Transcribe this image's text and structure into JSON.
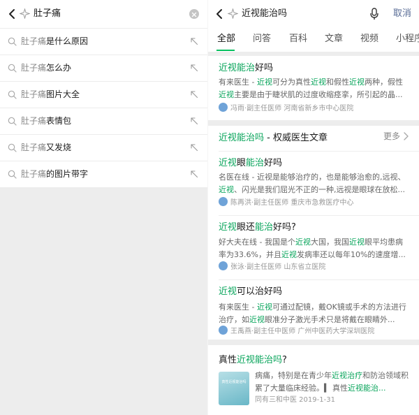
{
  "left": {
    "query": "肚子痛",
    "suggestions": [
      {
        "prefix": "肚子痛",
        "suffix": "是什么原因"
      },
      {
        "prefix": "肚子痛",
        "suffix": "怎么办"
      },
      {
        "prefix": "肚子痛",
        "suffix": "图片大全"
      },
      {
        "prefix": "肚子痛",
        "suffix": "表情包"
      },
      {
        "prefix": "肚子痛",
        "suffix": "又发烧"
      },
      {
        "prefix": "肚子痛",
        "suffix": "的图片带字"
      }
    ]
  },
  "right": {
    "query": "近视能治吗",
    "cancel_label": "取消",
    "tabs": [
      "全部",
      "问答",
      "百科",
      "文章",
      "视频",
      "小程序"
    ],
    "result1": {
      "title_hl": "近视能治",
      "title_rest": "好吗",
      "snippet": [
        {
          "t": "有来医生 - "
        },
        {
          "t": "近视",
          "h": true
        },
        {
          "t": "可分为真性"
        },
        {
          "t": "近视",
          "h": true
        },
        {
          "t": "和假性"
        },
        {
          "t": "近视",
          "h": true
        },
        {
          "t": "两种，假性"
        },
        {
          "t": "近视",
          "h": true
        },
        {
          "t": "主要是由于睫状肌的过度收缩痉挛，所引起的晶..."
        }
      ],
      "source": "冯雨·副主任医师 河南省新乡市中心医院"
    },
    "section": {
      "title_hl": "近视能治吗",
      "title_rest": " - 权威医生文章",
      "more_label": "更多"
    },
    "articles": [
      {
        "title": [
          {
            "t": "近视",
            "h": true
          },
          {
            "t": "眼"
          },
          {
            "t": "能治",
            "h": true
          },
          {
            "t": "好吗"
          }
        ],
        "snippet": [
          {
            "t": "名医在线 - 近视是能够治疗的，也是能够治愈的,远视、"
          },
          {
            "t": "近视",
            "h": true
          },
          {
            "t": "、闪光是我们屈光不正的一种,远视是眼球在放松..."
          }
        ],
        "source": "陈再洪·副主任医师 重庆市急救医疗中心"
      },
      {
        "title": [
          {
            "t": "近视",
            "h": true
          },
          {
            "t": "眼还"
          },
          {
            "t": "能治",
            "h": true
          },
          {
            "t": "好吗?"
          }
        ],
        "snippet": [
          {
            "t": "好大夫在线 - 我国是个"
          },
          {
            "t": "近视",
            "h": true
          },
          {
            "t": "大国，我国"
          },
          {
            "t": "近视",
            "h": true
          },
          {
            "t": "眼平均患病率为33.6%，并且"
          },
          {
            "t": "近视",
            "h": true
          },
          {
            "t": "发病率还以每年10%的速度增..."
          }
        ],
        "source": "张泳·副主任医师 山东省立医院"
      },
      {
        "title": [
          {
            "t": "近视",
            "h": true
          },
          {
            "t": "可以治好吗"
          }
        ],
        "snippet": [
          {
            "t": "有来医生 - "
          },
          {
            "t": "近视",
            "h": true
          },
          {
            "t": "可通过配镜，戴OK镜或手术的方法进行治疗，如"
          },
          {
            "t": "近视",
            "h": true
          },
          {
            "t": "眼准分子激光手术只是将戴在眼睛外..."
          }
        ],
        "source": "王禹燕·副主任中医师 广州中医药大学深圳医院"
      }
    ],
    "result_last": {
      "title": [
        {
          "t": "真性"
        },
        {
          "t": "近视能治吗",
          "h": true
        },
        {
          "t": "?"
        }
      ],
      "thumb_label": "真性近视能治吗",
      "snippet": [
        {
          "t": "病痛，特别是在青少年"
        },
        {
          "t": "近视治疗",
          "h": true
        },
        {
          "t": "和防治领域积累了大量临床经验。▍ 真性"
        },
        {
          "t": "近视能治...",
          "h": true
        }
      ],
      "source": "同有三和中医  2019-1-31"
    }
  },
  "colors": {
    "accent_green": "#07c160",
    "highlight_text": "#07a45a",
    "cancel_blue": "#576b95",
    "page_gray": "#ededed"
  },
  "icons": {
    "back": "chevron-left-icon",
    "sparkle": "sparkle-icon",
    "clear": "clear-circle-icon",
    "microphone": "microphone-icon",
    "search": "search-icon",
    "fill": "arrow-up-left-icon",
    "more": "chevron-right-icon"
  }
}
